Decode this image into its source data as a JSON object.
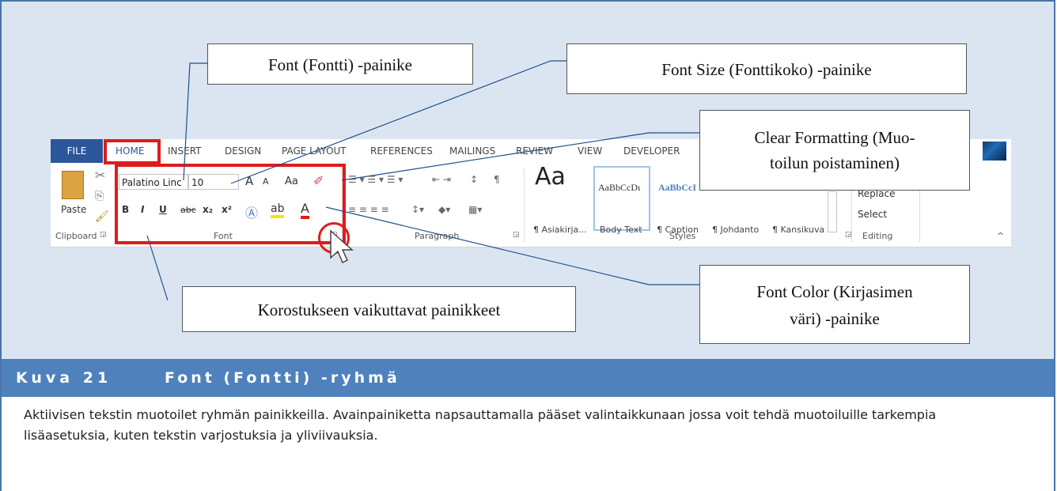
{
  "figure": {
    "label": "Kuva 21",
    "title": "Font (Fontti) -ryhmä",
    "description": "Aktiivisen tekstin muotoilet ryhmän painikkeilla. Avainpainiketta napsauttamalla pääset valintaikkunaan jossa voit tehdä muotoiluille tarkempia lisäasetuksia, kuten tekstin varjostuksia ja yliviivauksia."
  },
  "callouts": {
    "font": "Font (Fontti) -painike",
    "font_size": "Font Size (Fonttikoko) -painike",
    "clear_formatting_1": "Clear Formatting (Muo-",
    "clear_formatting_2": "toilun poistaminen)",
    "emphasis": "Korostukseen vaikuttavat painikkeet",
    "font_color_1": "Font Color (Kirjasimen",
    "font_color_2": "väri) -painike"
  },
  "ribbon": {
    "tabs": [
      "FILE",
      "HOME",
      "INSERT",
      "DESIGN",
      "PAGE LAYOUT",
      "REFERENCES",
      "MAILINGS",
      "REVIEW",
      "VIEW",
      "DEVELOPER"
    ],
    "clipboard": {
      "paste": "Paste",
      "label": "Clipboard"
    },
    "font": {
      "name": "Palatino Linc",
      "size": "10",
      "label": "Font",
      "case": "Aa",
      "bold": "B",
      "italic": "I",
      "underline": "U",
      "strike": "abc",
      "sub": "x₂",
      "sup": "x²",
      "grow": "A",
      "shrink": "A",
      "color": "A"
    },
    "paragraph": {
      "label": "Paragraph"
    },
    "styles": {
      "label": "Styles",
      "big_sample": "Aa",
      "samples": [
        "AaBbCcDı",
        "AaBbCcI"
      ],
      "names": [
        "¶ Asiakirja...",
        "Body Text",
        "¶ Caption",
        "¶ Johdanto",
        "¶ Kansikuva"
      ]
    },
    "editing": {
      "replace": "Replace",
      "select": "Select",
      "label": "Editing"
    }
  },
  "colors": {
    "accent": "#4f81bd",
    "panel": "#dbe5f1",
    "highlight": "#e01b1b",
    "file_tab": "#2b579a"
  }
}
